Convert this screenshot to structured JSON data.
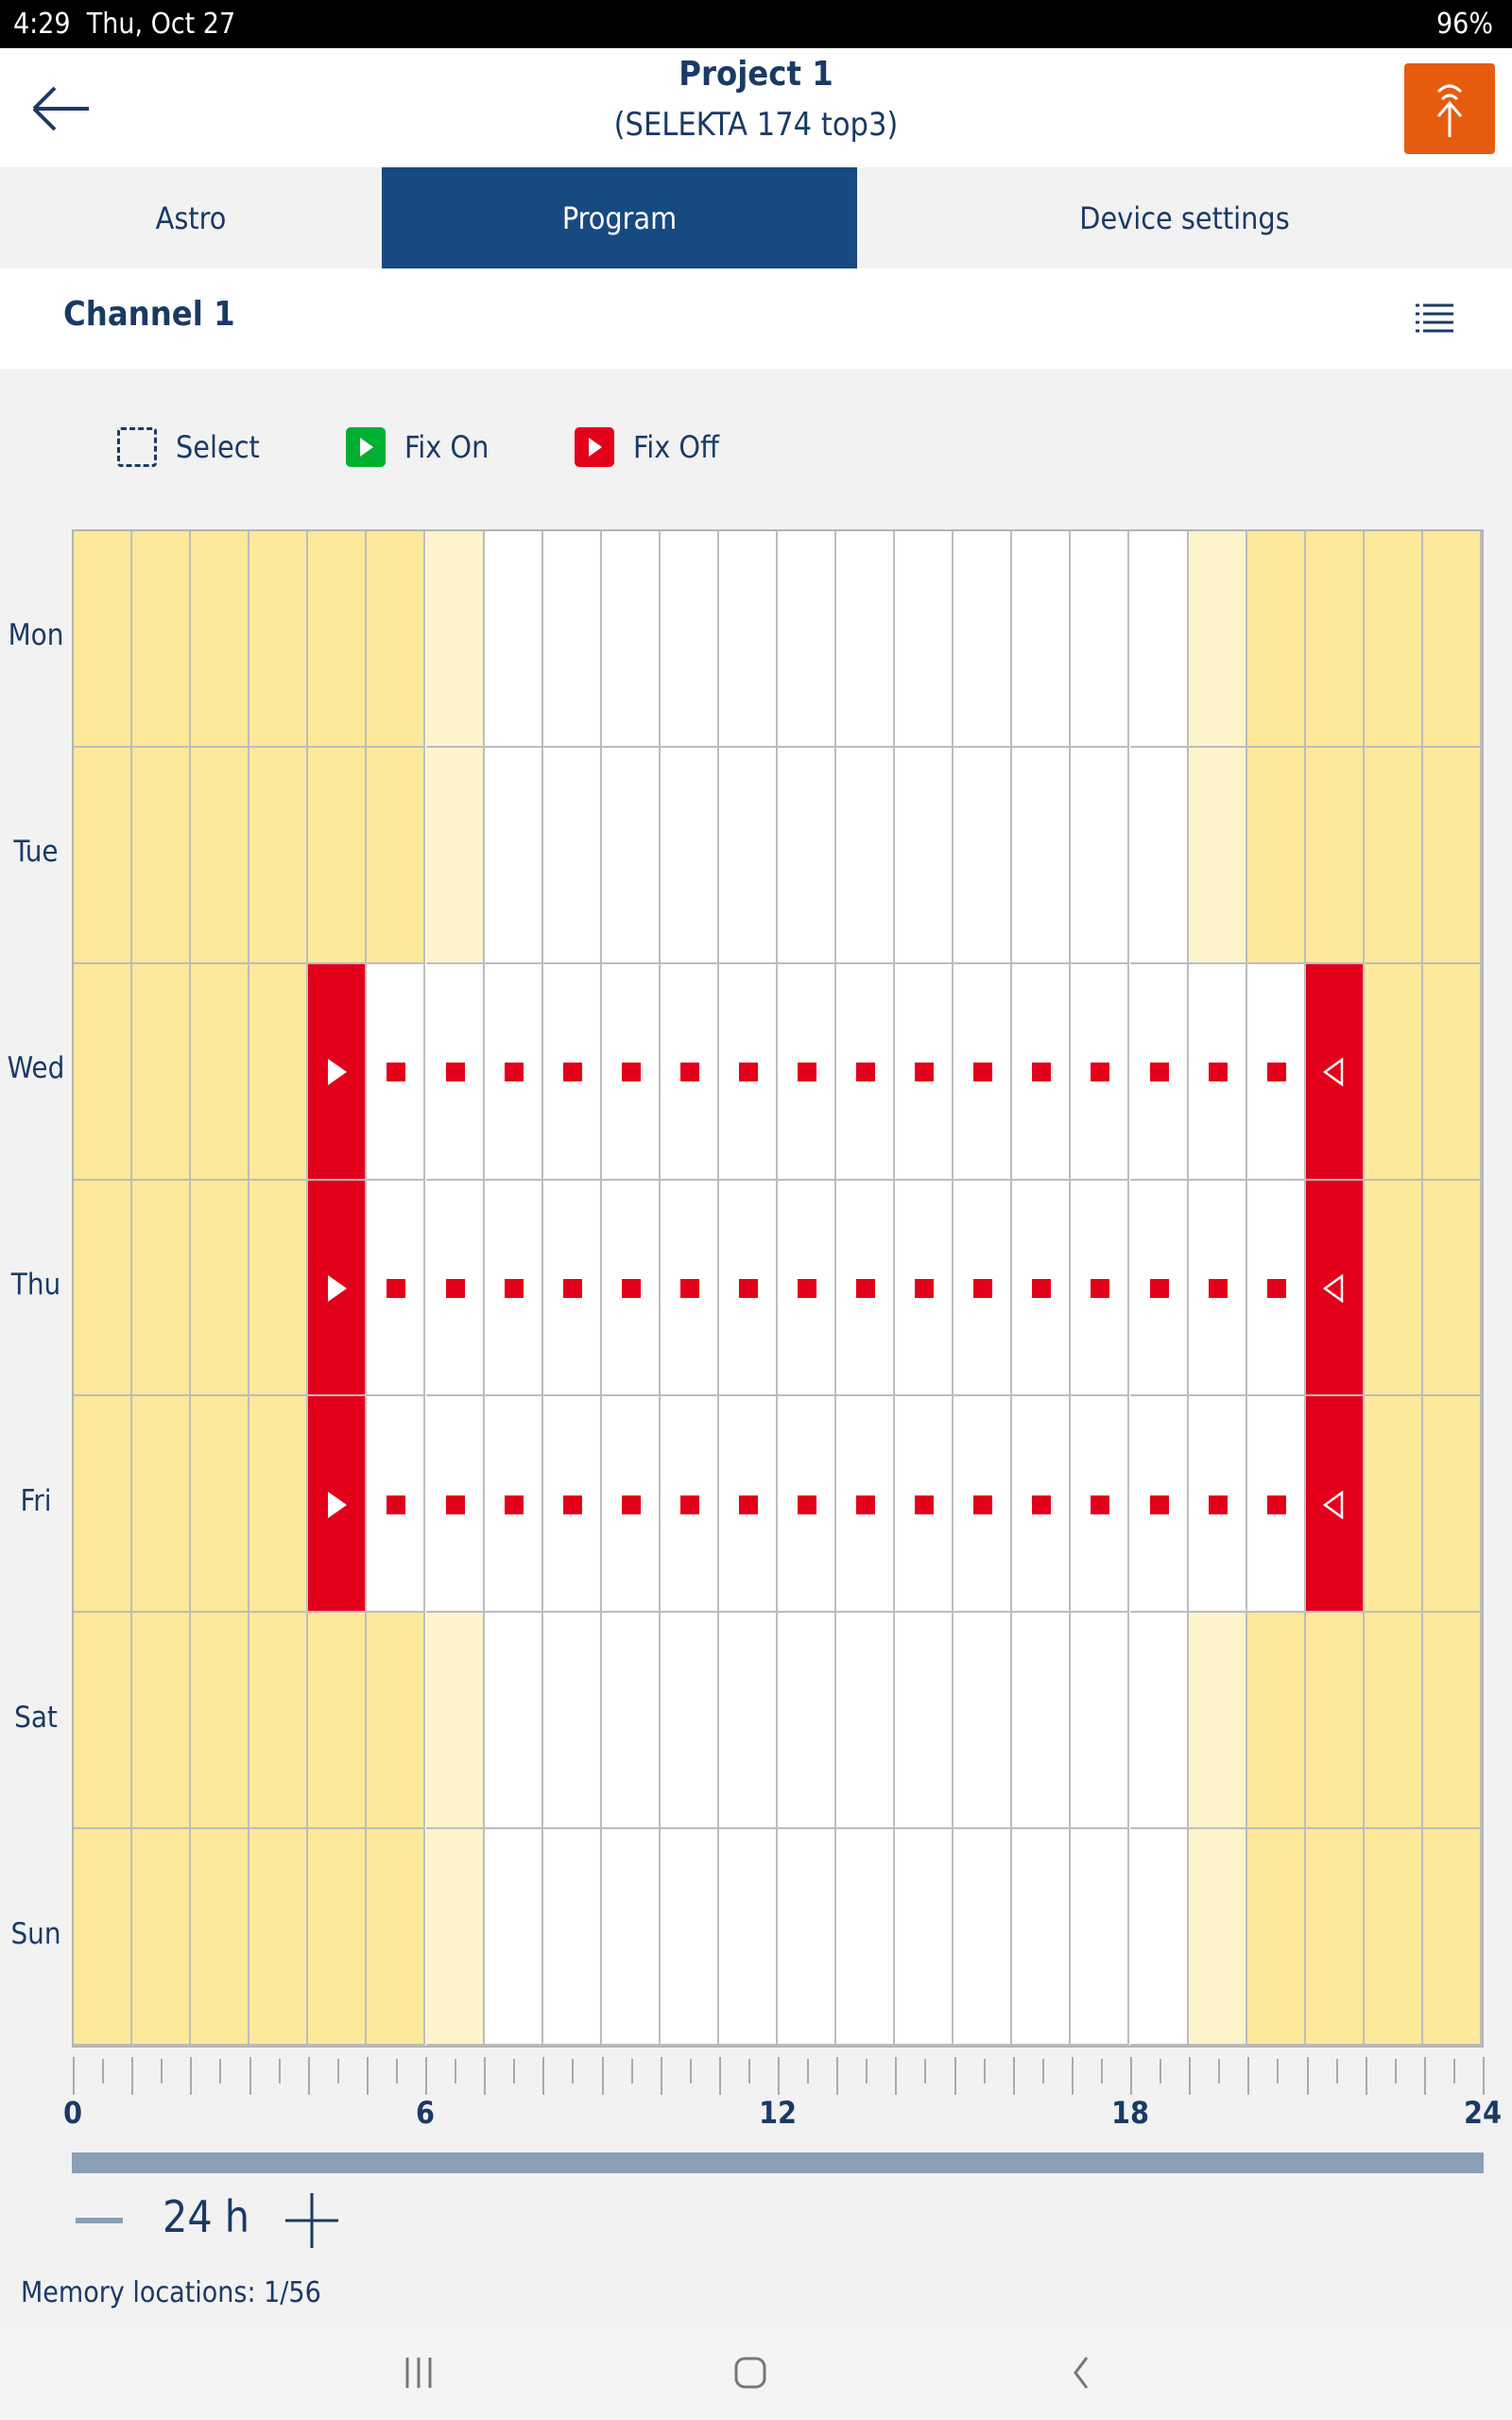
{
  "status_bar": {
    "time": "4:29",
    "date": "Thu, Oct 27",
    "battery": "96%"
  },
  "header": {
    "title": "Project 1",
    "subtitle": "(SELEKTA 174 top3)"
  },
  "tabs": [
    {
      "label": "Astro",
      "active": false
    },
    {
      "label": "Program",
      "active": true
    },
    {
      "label": "Device settings",
      "active": false
    }
  ],
  "channel": {
    "title": "Channel 1"
  },
  "legend": {
    "select": "Select",
    "fix_on": "Fix On",
    "fix_off": "Fix Off"
  },
  "colors": {
    "night": "#fde99a",
    "twilight": "#fdf4cc",
    "day": "#ffffff",
    "fix_on": "#00b030",
    "fix_off": "#e2001a",
    "accent": "#174a80",
    "upload": "#e65c0f"
  },
  "schedule": {
    "cell_legend": {
      "Y": "night",
      "P": "twilight",
      "W": "day",
      "N": "fix-off start",
      "S": "fix-off active",
      "F": "fix-off end"
    },
    "days": [
      {
        "label": "Mon",
        "cells": "YYYYYYPWWWWWWWWWWWWPYYYY"
      },
      {
        "label": "Tue",
        "cells": "YYYYYYPWWWWWWWWWWWWPYYYY"
      },
      {
        "label": "Wed",
        "cells": "YYYYNSSSSSSSSSSSSSSSSFYY"
      },
      {
        "label": "Thu",
        "cells": "YYYYNSSSSSSSSSSSSSSSSFYY"
      },
      {
        "label": "Fri",
        "cells": "YYYYNSSSSSSSSSSSSSSSSFYY"
      },
      {
        "label": "Sat",
        "cells": "YYYYYYPWWWWWWWWWWWWPYYYY"
      },
      {
        "label": "Sun",
        "cells": "YYYYYYPWWWWWWWWWWWWPYYYY"
      }
    ],
    "axis_labels": [
      "0",
      "6",
      "12",
      "18",
      "24"
    ]
  },
  "zoom": {
    "value": "24 h"
  },
  "memory": {
    "text": "Memory locations: 1/56"
  }
}
